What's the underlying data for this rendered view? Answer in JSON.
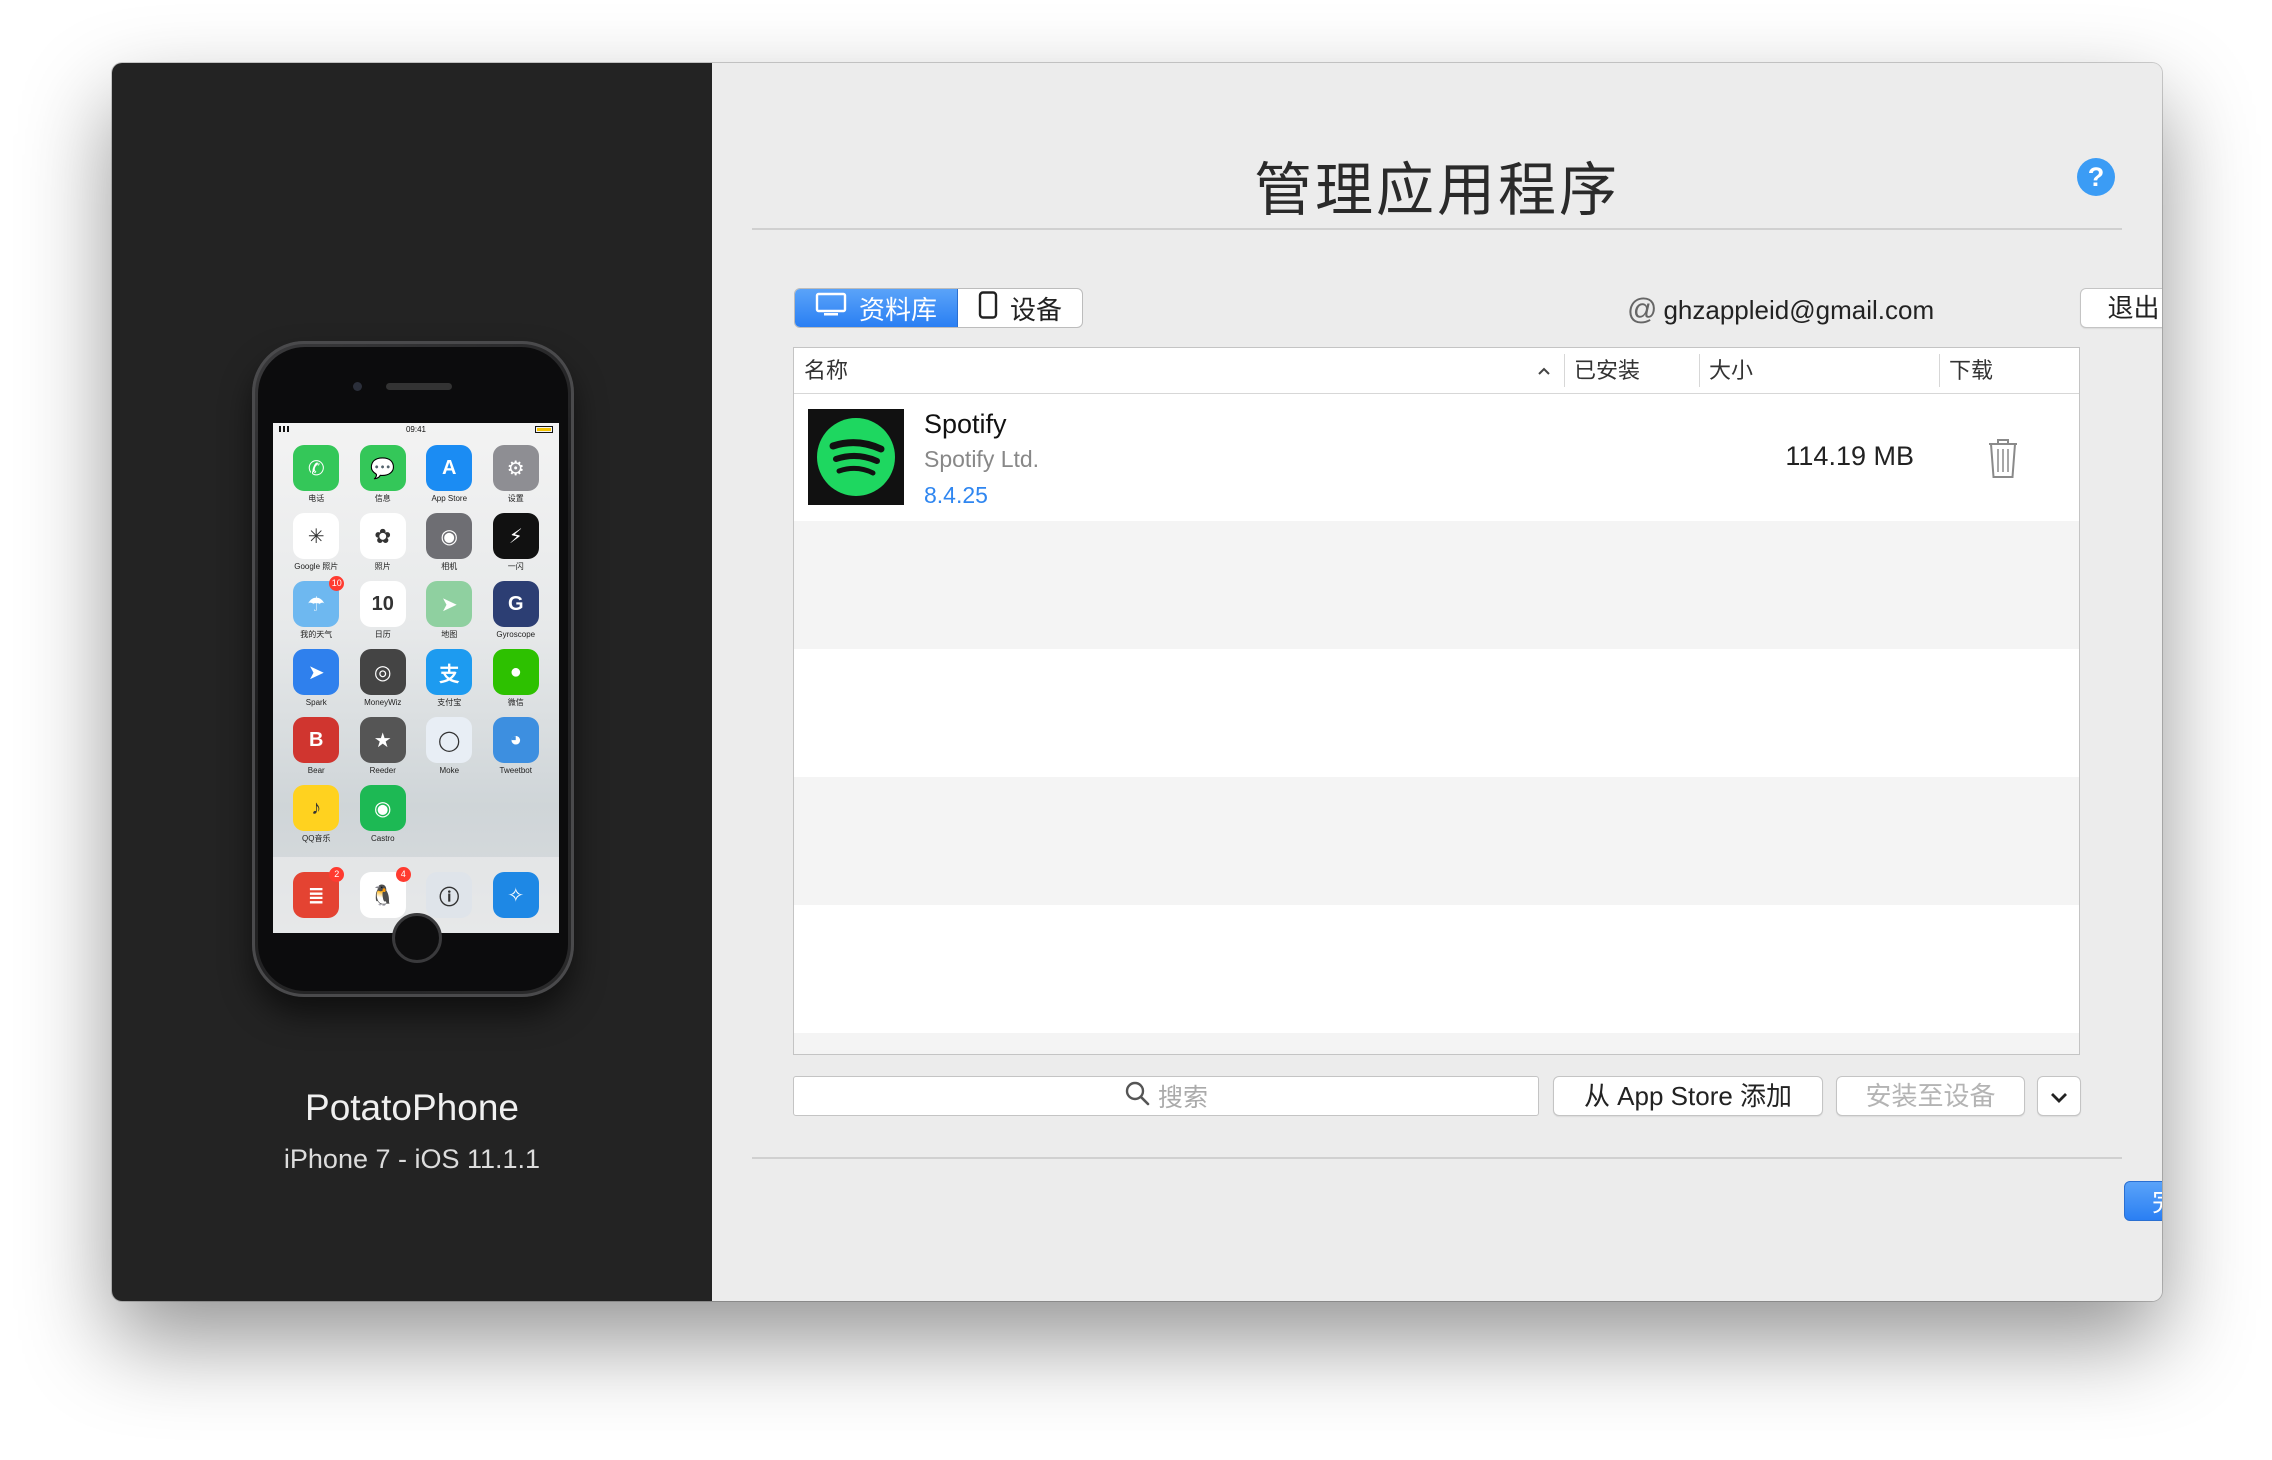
{
  "device": {
    "name": "PotatoPhone",
    "model": "iPhone 7 - iOS 11.1.1",
    "status_time": "09:41",
    "home_apps": [
      {
        "label": "电话",
        "color": "#34c759",
        "glyph": "✆",
        "badge": ""
      },
      {
        "label": "信息",
        "color": "#34c759",
        "glyph": "💬",
        "badge": ""
      },
      {
        "label": "App Store",
        "color": "#1b8cf3",
        "glyph": "A",
        "badge": ""
      },
      {
        "label": "设置",
        "color": "#8e8e93",
        "glyph": "⚙",
        "badge": ""
      },
      {
        "label": "Google 照片",
        "color": "#ffffff",
        "glyph": "✳",
        "badge": ""
      },
      {
        "label": "照片",
        "color": "#ffffff",
        "glyph": "✿",
        "badge": ""
      },
      {
        "label": "相机",
        "color": "#6e6e73",
        "glyph": "◉",
        "badge": ""
      },
      {
        "label": "一闪",
        "color": "#111111",
        "glyph": "⚡",
        "badge": ""
      },
      {
        "label": "我的天气",
        "color": "#6eb8f0",
        "glyph": "☂",
        "badge": "10"
      },
      {
        "label": "日历",
        "color": "#ffffff",
        "glyph": "10",
        "badge": ""
      },
      {
        "label": "地图",
        "color": "#8fd0a0",
        "glyph": "➤",
        "badge": ""
      },
      {
        "label": "Gyroscope",
        "color": "#2c3e73",
        "glyph": "G",
        "badge": ""
      },
      {
        "label": "Spark",
        "color": "#2f80ed",
        "glyph": "➤",
        "badge": ""
      },
      {
        "label": "MoneyWiz",
        "color": "#444444",
        "glyph": "◎",
        "badge": ""
      },
      {
        "label": "支付宝",
        "color": "#1d9bf0",
        "glyph": "支",
        "badge": ""
      },
      {
        "label": "微信",
        "color": "#2dc100",
        "glyph": "●",
        "badge": ""
      },
      {
        "label": "Bear",
        "color": "#d0352f",
        "glyph": "B",
        "badge": ""
      },
      {
        "label": "Reeder",
        "color": "#555555",
        "glyph": "★",
        "badge": ""
      },
      {
        "label": "Moke",
        "color": "#e8eef5",
        "glyph": "◯",
        "badge": ""
      },
      {
        "label": "Tweetbot",
        "color": "#3d8fe0",
        "glyph": "◕",
        "badge": ""
      },
      {
        "label": "QQ音乐",
        "color": "#ffd21f",
        "glyph": "♪",
        "badge": ""
      },
      {
        "label": "Castro",
        "color": "#1db954",
        "glyph": "◉",
        "badge": ""
      }
    ],
    "dock_apps": [
      {
        "label": "",
        "color": "#e44332",
        "glyph": "≣",
        "badge": "2"
      },
      {
        "label": "",
        "color": "#ffffff",
        "glyph": "🐧",
        "badge": "4"
      },
      {
        "label": "",
        "color": "#dfe4ea",
        "glyph": "ⓘ",
        "badge": ""
      },
      {
        "label": "",
        "color": "#1e88e5",
        "glyph": "✧",
        "badge": ""
      }
    ]
  },
  "panel": {
    "title": "管理应用程序",
    "help_label": "?",
    "tabs": {
      "library": "资料库",
      "device": "设备"
    },
    "account_icon": "@",
    "account_email": "ghzappleid@gmail.com",
    "logout_label": "退出",
    "table": {
      "columns": {
        "name": "名称",
        "installed": "已安装",
        "size": "大小",
        "download": "下载"
      },
      "sort_indicator": "^",
      "rows": [
        {
          "name": "Spotify",
          "developer": "Spotify Ltd.",
          "version": "8.4.25",
          "installed": "",
          "size": "114.19 MB",
          "icon": "spotify-icon",
          "icon_color": "#1ed760"
        }
      ]
    },
    "search_placeholder": "搜索",
    "add_label": "从 App Store 添加",
    "install_label": "安装至设备",
    "more_icon": "chevron-down-icon",
    "done_label": "完成"
  },
  "colors": {
    "accent": "#2f86f0",
    "sidebar_bg": "#232323",
    "panel_bg": "#ececec",
    "spotify_green": "#1ed760"
  }
}
